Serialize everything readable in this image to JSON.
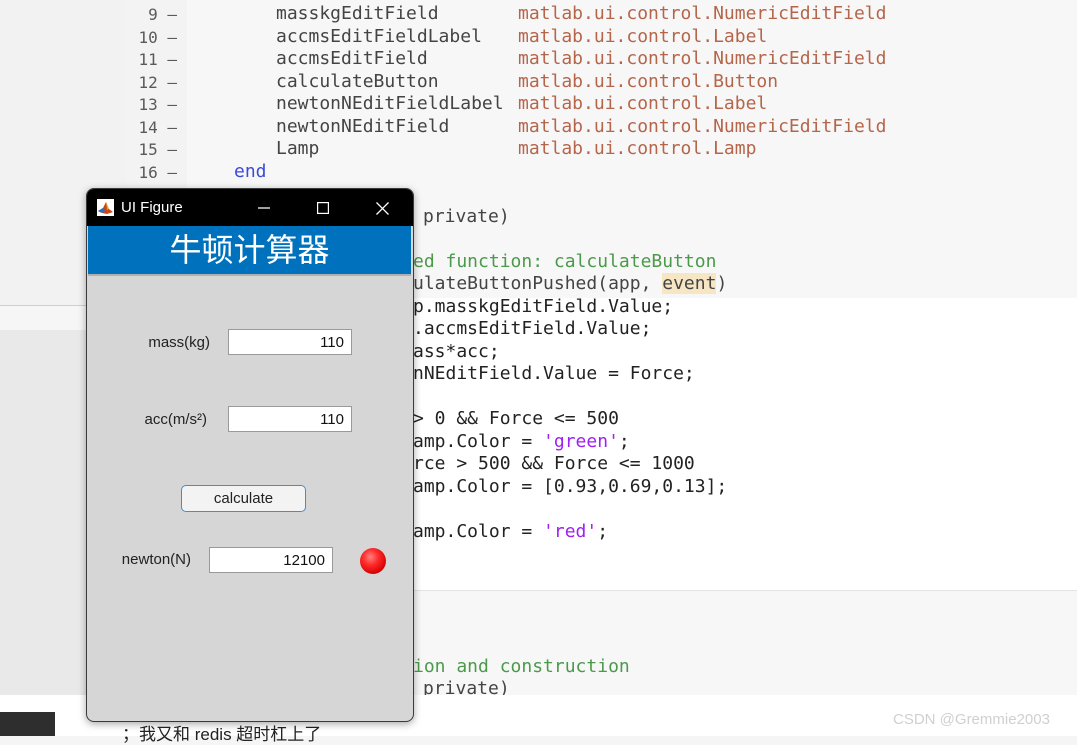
{
  "editor": {
    "lines_top": [
      {
        "num": "9",
        "name": "masskgEditField",
        "cls": "matlab.ui.control.NumericEditField"
      },
      {
        "num": "10",
        "name": "accmsEditFieldLabel",
        "cls": "matlab.ui.control.Label"
      },
      {
        "num": "11",
        "name": "accmsEditField",
        "cls": "matlab.ui.control.NumericEditField"
      },
      {
        "num": "12",
        "name": "calculateButton",
        "cls": "matlab.ui.control.Button"
      },
      {
        "num": "13",
        "name": "newtonNEditFieldLabel",
        "cls": "matlab.ui.control.Label"
      },
      {
        "num": "14",
        "name": "newtonNEditField",
        "cls": "matlab.ui.control.NumericEditField"
      },
      {
        "num": "15",
        "name": "Lamp",
        "cls": "matlab.ui.control.Lamp"
      }
    ],
    "line16_num": "16",
    "line16_kw": "end",
    "private1": "private)",
    "comment1": "ed function: calculateButton",
    "func_sig_a": "ulateButtonPushed(app, ",
    "func_sig_hl": "event",
    "func_sig_b": ")",
    "code1": "p.masskgEditField.Value;",
    "code2": ".accmsEditField.Value;",
    "code3": "ass*acc;",
    "code4": "nNEditField.Value = Force;",
    "code5": "> 0 && Force <= 500",
    "code6a": "amp.Color = ",
    "code6s": "'green'",
    "code6b": ";",
    "code7": "rce > 500 && Force <= 1000",
    "code8": "amp.Color = [0.93,0.69,0.13];",
    "code9a": "amp.Color = ",
    "code9s": "'red'",
    "code9b": ";",
    "comment2": "ion and construction",
    "private2": "private)"
  },
  "bottom_text": "；我又和 redis 超时杠上了",
  "watermark": "CSDN @Gremmie2003",
  "ui_figure": {
    "title": "UI Figure",
    "header": "牛顿计算器",
    "mass_label": "mass(kg)",
    "mass_value": "110",
    "acc_label": "acc(m/s²)",
    "acc_value": "110",
    "calculate_label": "calculate",
    "newton_label": "newton(N)",
    "newton_value": "12100",
    "lamp_color": "#ff0000"
  },
  "icons": {
    "app": "matlab-icon",
    "minimize": "minimize-icon",
    "maximize": "maximize-icon",
    "close": "close-icon"
  }
}
